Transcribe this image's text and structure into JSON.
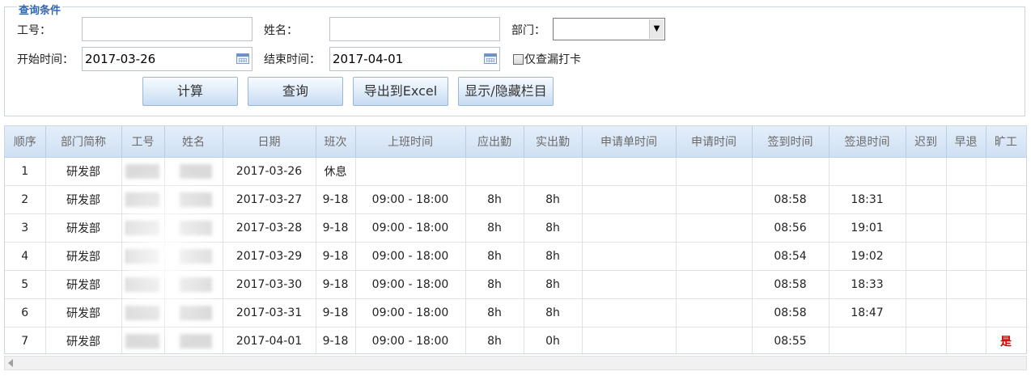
{
  "query": {
    "legend": "查询条件",
    "emp_no_label": "工号：",
    "emp_no_value": "",
    "name_label": "姓名：",
    "name_value": "",
    "dept_label": "部门：",
    "dept_value": "",
    "start_label": "开始时间：",
    "start_value": "2017-03-26",
    "end_label": "结束时间：",
    "end_value": "2017-04-01",
    "only_missing_label": "仅查漏打卡",
    "only_missing_checked": false
  },
  "buttons": {
    "calc": "计算",
    "search": "查询",
    "export": "导出到Excel",
    "toggle_cols": "显示/隐藏栏目"
  },
  "table": {
    "headers": [
      "顺序",
      "部门简称",
      "工号",
      "姓名",
      "日期",
      "班次",
      "上班时间",
      "应出勤",
      "实出勤",
      "申请单时间",
      "申请时间",
      "签到时间",
      "签退时间",
      "迟到",
      "早退",
      "旷工"
    ],
    "rows": [
      {
        "seq": "1",
        "dept": "研发部",
        "date": "2017-03-26",
        "shift": "休息",
        "work_time": "",
        "should": "",
        "actual": "",
        "apply_form": "",
        "apply_time": "",
        "sign_in": "",
        "sign_out": "",
        "late": "",
        "early": "",
        "absent": ""
      },
      {
        "seq": "2",
        "dept": "研发部",
        "date": "2017-03-27",
        "shift": "9-18",
        "work_time": "09:00 - 18:00",
        "should": "8h",
        "actual": "8h",
        "apply_form": "",
        "apply_time": "",
        "sign_in": "08:58",
        "sign_out": "18:31",
        "late": "",
        "early": "",
        "absent": ""
      },
      {
        "seq": "3",
        "dept": "研发部",
        "date": "2017-03-28",
        "shift": "9-18",
        "work_time": "09:00 - 18:00",
        "should": "8h",
        "actual": "8h",
        "apply_form": "",
        "apply_time": "",
        "sign_in": "08:56",
        "sign_out": "19:01",
        "late": "",
        "early": "",
        "absent": ""
      },
      {
        "seq": "4",
        "dept": "研发部",
        "date": "2017-03-29",
        "shift": "9-18",
        "work_time": "09:00 - 18:00",
        "should": "8h",
        "actual": "8h",
        "apply_form": "",
        "apply_time": "",
        "sign_in": "08:54",
        "sign_out": "19:02",
        "late": "",
        "early": "",
        "absent": ""
      },
      {
        "seq": "5",
        "dept": "研发部",
        "date": "2017-03-30",
        "shift": "9-18",
        "work_time": "09:00 - 18:00",
        "should": "8h",
        "actual": "8h",
        "apply_form": "",
        "apply_time": "",
        "sign_in": "08:58",
        "sign_out": "18:33",
        "late": "",
        "early": "",
        "absent": ""
      },
      {
        "seq": "6",
        "dept": "研发部",
        "date": "2017-03-31",
        "shift": "9-18",
        "work_time": "09:00 - 18:00",
        "should": "8h",
        "actual": "8h",
        "apply_form": "",
        "apply_time": "",
        "sign_in": "08:58",
        "sign_out": "18:47",
        "late": "",
        "early": "",
        "absent": ""
      },
      {
        "seq": "7",
        "dept": "研发部",
        "date": "2017-04-01",
        "shift": "9-18",
        "work_time": "09:00 - 18:00",
        "should": "8h",
        "actual": "0h",
        "apply_form": "",
        "apply_time": "",
        "sign_in": "08:55",
        "sign_out": "",
        "late": "",
        "early": "",
        "absent": "是"
      }
    ]
  },
  "colors": {
    "legend": "#2d68b5",
    "header_bg": "#d9e7f7",
    "absent_text": "#d40000"
  }
}
